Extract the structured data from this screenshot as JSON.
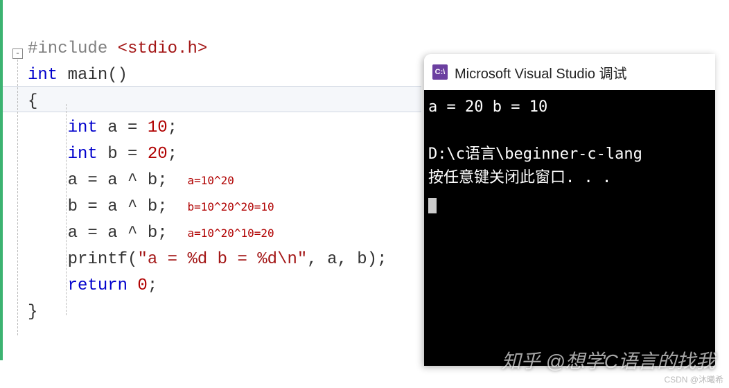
{
  "code": {
    "include_directive": "#include",
    "header": "<stdio.h>",
    "fold_glyph": "-",
    "kw_int": "int",
    "fn_main": "main",
    "parens": "()",
    "brace_open": "{",
    "decl_a": "int",
    "decl_a_name": " a = ",
    "decl_a_val": "10",
    "semicolon": ";",
    "decl_b": "int",
    "decl_b_name": " b = ",
    "decl_b_val": "20",
    "line5": "a = a ^ b;",
    "annot5": "a=10^20",
    "line6": "b = a ^ b;",
    "annot6": "b=10^20^20=10",
    "line7": "a = a ^ b;",
    "annot7": "a=10^20^10=20",
    "printf_fn": "printf",
    "printf_open": "(",
    "printf_str": "\"a = %d b = %d\\n\"",
    "printf_rest": ", a, b);",
    "return_kw": "return",
    "return_val": " 0",
    "brace_close": "}"
  },
  "console": {
    "title_icon": "C:\\",
    "title": "Microsoft Visual Studio 调试",
    "output_line1": "a = 20 b = 10",
    "output_line2": "",
    "output_line3": "D:\\c语言\\beginner-c-lang",
    "output_line4": "按任意键关闭此窗口. . ."
  },
  "watermarks": {
    "zhihu": "知乎 @想学C语言的找我",
    "csdn": "CSDN @沐曦希"
  }
}
